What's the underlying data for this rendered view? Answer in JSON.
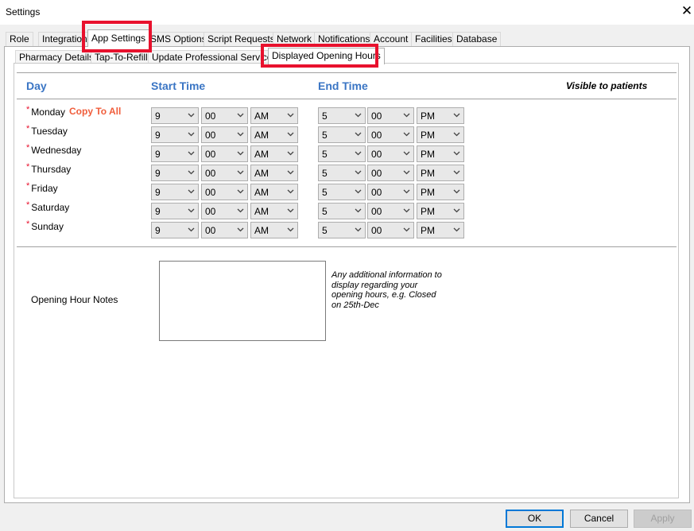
{
  "window": {
    "title": "Settings",
    "close_glyph": "✕"
  },
  "tabs": [
    "Role",
    "Integration",
    "App Settings",
    "SMS Options",
    "Script Requests",
    "Network",
    "Notifications",
    "Account",
    "Facilities",
    "Database"
  ],
  "subtabs": [
    "Pharmacy Details",
    "Tap-To-Refill",
    "Update Professional Services",
    "Displayed Opening Hours"
  ],
  "headers": {
    "day": "Day",
    "start": "Start Time",
    "end": "End Time",
    "visible": "Visible to patients"
  },
  "copy_to_all": "Copy To All",
  "days": [
    {
      "name": "Monday",
      "start_hour": "9",
      "start_min": "00",
      "start_ampm": "AM",
      "end_hour": "5",
      "end_min": "00",
      "end_ampm": "PM"
    },
    {
      "name": "Tuesday",
      "start_hour": "9",
      "start_min": "00",
      "start_ampm": "AM",
      "end_hour": "5",
      "end_min": "00",
      "end_ampm": "PM"
    },
    {
      "name": "Wednesday",
      "start_hour": "9",
      "start_min": "00",
      "start_ampm": "AM",
      "end_hour": "5",
      "end_min": "00",
      "end_ampm": "PM"
    },
    {
      "name": "Thursday",
      "start_hour": "9",
      "start_min": "00",
      "start_ampm": "AM",
      "end_hour": "5",
      "end_min": "00",
      "end_ampm": "PM"
    },
    {
      "name": "Friday",
      "start_hour": "9",
      "start_min": "00",
      "start_ampm": "AM",
      "end_hour": "5",
      "end_min": "00",
      "end_ampm": "PM"
    },
    {
      "name": "Saturday",
      "start_hour": "9",
      "start_min": "00",
      "start_ampm": "AM",
      "end_hour": "5",
      "end_min": "00",
      "end_ampm": "PM"
    },
    {
      "name": "Sunday",
      "start_hour": "9",
      "start_min": "00",
      "start_ampm": "AM",
      "end_hour": "5",
      "end_min": "00",
      "end_ampm": "PM"
    }
  ],
  "notes": {
    "label": "Opening Hour Notes",
    "value": "",
    "hint": "Any additional information to display regarding your opening hours, e.g. Closed on 25th-Dec"
  },
  "buttons": {
    "ok": "OK",
    "cancel": "Cancel",
    "apply": "Apply"
  },
  "colors": {
    "highlight": "#e8112d",
    "header_blue": "#3a75c4",
    "copy_all": "#f05d3b",
    "required": "#e8112d"
  }
}
